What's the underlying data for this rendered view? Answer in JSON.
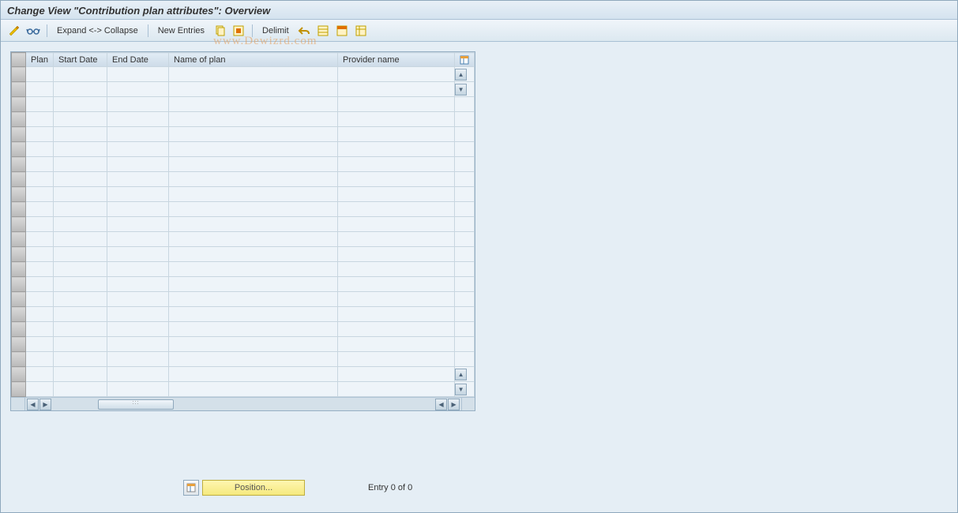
{
  "window": {
    "title": "Change View \"Contribution plan attributes\": Overview"
  },
  "toolbar": {
    "expand_collapse": "Expand <-> Collapse",
    "new_entries": "New Entries",
    "delimit": "Delimit"
  },
  "watermark": "www.Dewizrd.com",
  "table": {
    "columns": {
      "plan": "Plan",
      "start_date": "Start Date",
      "end_date": "End Date",
      "name_of_plan": "Name of plan",
      "provider_name": "Provider name"
    }
  },
  "footer": {
    "position_label": "Position...",
    "entry_status": "Entry 0 of 0"
  }
}
